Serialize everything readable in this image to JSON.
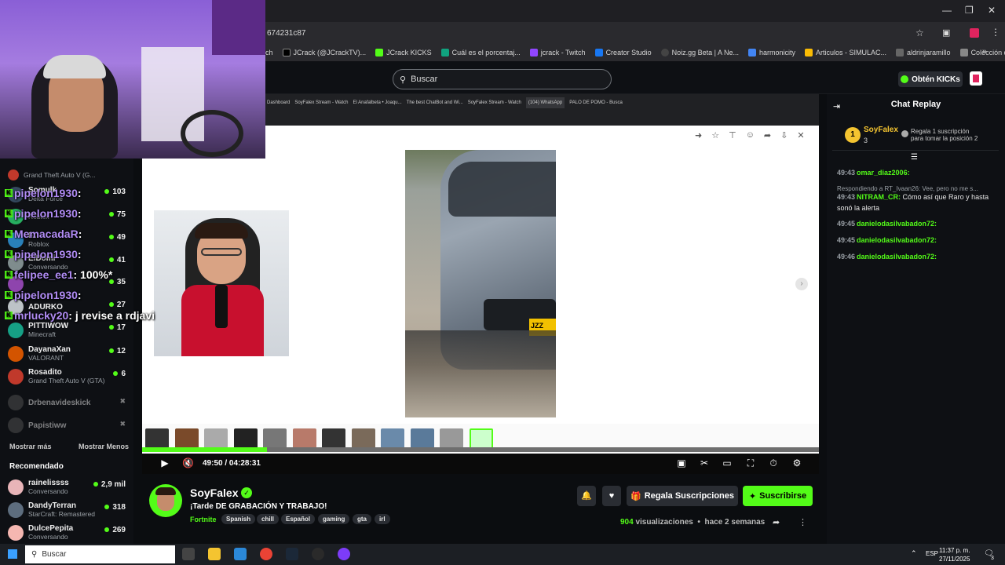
{
  "browser": {
    "url_fragment": "674231c87",
    "bookmarks": [
      "ch",
      "JCrack (@JCrackTV)...",
      "JCrack KICKS",
      "Cuál es el porcentaj...",
      "jcrack - Twitch",
      "Creator Studio",
      "Noiz.gg Beta | A Ne...",
      "harmonicity",
      "Articulos - SIMULAC...",
      "aldrinjaramillo",
      "Colección de M_blei..."
    ]
  },
  "header": {
    "search_placeholder": "Buscar",
    "get_kicks_label": "Obtén KICKs"
  },
  "sidebar": {
    "channels": [
      {
        "name": "",
        "game": "Grand Theft Auto V (G...",
        "count": ""
      },
      {
        "name": "Somulk",
        "game": "Delta Force",
        "count": "103"
      },
      {
        "name": "",
        "game": "Roblox",
        "count": "75"
      },
      {
        "name": "F...",
        "game": "Roblox",
        "count": "49"
      },
      {
        "name": "ElDomi",
        "game": "Conversando",
        "count": "41"
      },
      {
        "name": "",
        "game": "",
        "count": "35"
      },
      {
        "name": "ADURKO",
        "game": "",
        "count": "27"
      },
      {
        "name": "PITTIWOW",
        "game": "Minecraft",
        "count": "17"
      },
      {
        "name": "DayanaXan",
        "game": "VALORANT",
        "count": "12"
      },
      {
        "name": "Rosadito",
        "game": "Grand Theft Auto V (GTA)",
        "count": "6"
      },
      {
        "name": "Drbenavideskick",
        "game": "",
        "count": ""
      },
      {
        "name": "Papistiww",
        "game": "",
        "count": ""
      }
    ],
    "show_more": "Mostrar más",
    "show_less": "Mostrar Menos",
    "recommended_title": "Recomendado",
    "recommended": [
      {
        "name": "rainelissss",
        "game": "Conversando",
        "count": "2,9 mil"
      },
      {
        "name": "DandyTerran",
        "game": "StarCraft: Remastered",
        "count": "318"
      },
      {
        "name": "DulcePepita",
        "game": "Conversando",
        "count": "269"
      }
    ]
  },
  "overlay_chat": [
    {
      "user": "pipelon1930",
      "text": ":",
      "count": ""
    },
    {
      "user": "pipelon1930",
      "text": ":",
      "count": ""
    },
    {
      "user": "MemacadaR",
      "text": ":",
      "count": ""
    },
    {
      "user": "pipelon1930",
      "text": ":",
      "count": ""
    },
    {
      "user": "felipee_ee1",
      "text": ": 100%*",
      "count": ""
    },
    {
      "user": "pipelon1930",
      "text": ":",
      "count": ""
    },
    {
      "user": "mrlucky20",
      "text": ": j revise a rdjavi",
      "count": ""
    }
  ],
  "inner_browser": {
    "tabs": [
      "Dashboard",
      "SoyFalex Stream - Watch",
      "El Anafalbeta • Joaqu...",
      "The best ChatBot and Wi...",
      "SoyFalex Stream - Watch",
      "(104) WhatsApp",
      "PALO DE POMO - Busca"
    ],
    "taskbar_search": "Buscar"
  },
  "player": {
    "time": "49:50 / 04:28:31",
    "progress": 0.185
  },
  "chat": {
    "title": "Chat Replay",
    "gifter": "SoyFalex",
    "gifter_count": "3",
    "gift_text_1": "Regala 1 suscripción",
    "gift_text_2": "para tomar la posición 2",
    "messages": [
      {
        "time": "49:43",
        "user": "omar_diaz2006:",
        "text": "",
        "color": "#53fc18"
      },
      {
        "time": "",
        "user": "",
        "text": "Respondiendo a RT_Ivaan26: Vee, pero no me s...",
        "color": "#9aa0a6"
      },
      {
        "time": "49:43",
        "user": "NITRAM_CR:",
        "text": "Cómo así que Raro y hasta sonó la alerta",
        "color": "#53fc18"
      },
      {
        "time": "49:45",
        "user": "danielodasilvabadon72:",
        "text": "",
        "color": "#53fc18"
      },
      {
        "time": "49:45",
        "user": "danielodasilvabadon72:",
        "text": "",
        "color": "#53fc18"
      },
      {
        "time": "49:46",
        "user": "danielodasilvabadon72:",
        "text": "",
        "color": "#53fc18"
      }
    ]
  },
  "stream": {
    "name": "SoyFalex",
    "title": "¡Tarde DE GRABACIÓN Y TRABAJO!",
    "category": "Fortnite",
    "tags": [
      "Spanish",
      "chill",
      "Español",
      "gaming",
      "gta",
      "irl"
    ],
    "gift_label": "Regala Suscripciones",
    "subscribe_label": "Suscribirse",
    "views_count": "904",
    "views_label": "visualizaciones",
    "ago": "hace 2 semanas"
  },
  "taskbar": {
    "search": "Buscar",
    "lang": "ESP",
    "time": "11:37 p. m.",
    "date": "27/11/2025",
    "notifications": "3"
  }
}
